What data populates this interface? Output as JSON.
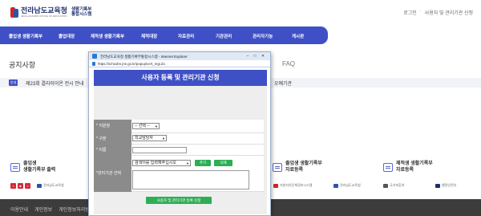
{
  "header": {
    "logo_title": "전라남도교육청",
    "logo_sub": "JEOLLANAMDO OFFICE OF EDUCATION",
    "logo_sys_1": "생활기록부",
    "logo_sys_2": "통합시스템",
    "util": [
      "로그인",
      "·",
      "사용자 및 관리기관 신청"
    ]
  },
  "nav": {
    "items": [
      "졸업생 생활기록부",
      "졸업대장",
      "제적생 생활기록부",
      "제적대장",
      "자료관리",
      "기관관리",
      "관리자기능",
      "게시판"
    ]
  },
  "page": {
    "section_title": "공지사항",
    "faq": "FAQ",
    "notice_badge": "안내",
    "notice_text": "제23회 결리러이온 전시 안내",
    "notice_right": "오예기관"
  },
  "quick": [
    {
      "l1": "졸업생",
      "l2": "생활기록부 출력"
    },
    {
      "l1": "졸업생 생활기록부",
      "l2": "자료등록"
    },
    {
      "l1": "제적생 생활기록부",
      "l2": "자료등록"
    }
  ],
  "nav_buttons": [
    "<",
    "■",
    ">"
  ],
  "partners": [
    "전라남도교육청",
    "지방자치단체정보시스템",
    "전라남도교육청",
    "국가보훈처",
    "행정안전부"
  ],
  "footer": {
    "links": [
      "이용안내",
      "개인정보",
      "개인정보처리방침"
    ]
  },
  "popup": {
    "window_title": "전라남도교육청 생활기록부통합시스템 - Internet Explorer",
    "url": "https://schoolre.jne.go.kr/popup/cert_regi.do",
    "controls": [
      "–",
      "□",
      "✕"
    ],
    "header": "사용자 등록 및 관리기관 신청",
    "form": {
      "region_label": "* 지원청",
      "region_value": "-- 선택 --",
      "type_label": "* 구분",
      "type_value": "학교담당자",
      "name_label": "* 이름",
      "org_label": "*관리기관 선택",
      "org_placeholder": "검색어를 입력해주십시오",
      "add_button": "추가",
      "delete_button": "삭제"
    },
    "submit": "사용자 및 관리기관 등록 신청"
  },
  "colors": {
    "brand": "#3f50c6",
    "accent": "#2dae55"
  }
}
